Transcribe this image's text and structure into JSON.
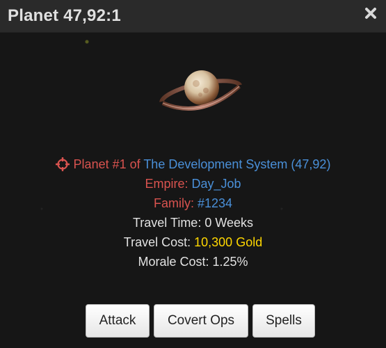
{
  "window": {
    "title": "Planet 47,92:1",
    "close_icon": "close-icon"
  },
  "planet": {
    "location_prefix": "Planet #1 of",
    "system_name": "The Development System (47,92)",
    "empire_label": "Empire:",
    "empire_name": "Day_Job",
    "family_label": "Family:",
    "family_value": "#1234",
    "travel_time": "Travel Time: 0 Weeks",
    "travel_cost_label": "Travel Cost:",
    "travel_cost_value": "10,300 Gold",
    "morale_cost": "Morale Cost: 1.25%"
  },
  "actions": {
    "attack": "Attack",
    "covert_ops": "Covert Ops",
    "spells": "Spells"
  },
  "colors": {
    "label_red": "#d9534f",
    "link_blue": "#4a90d9",
    "gold": "#ffd700",
    "text": "#e2e2e2"
  }
}
